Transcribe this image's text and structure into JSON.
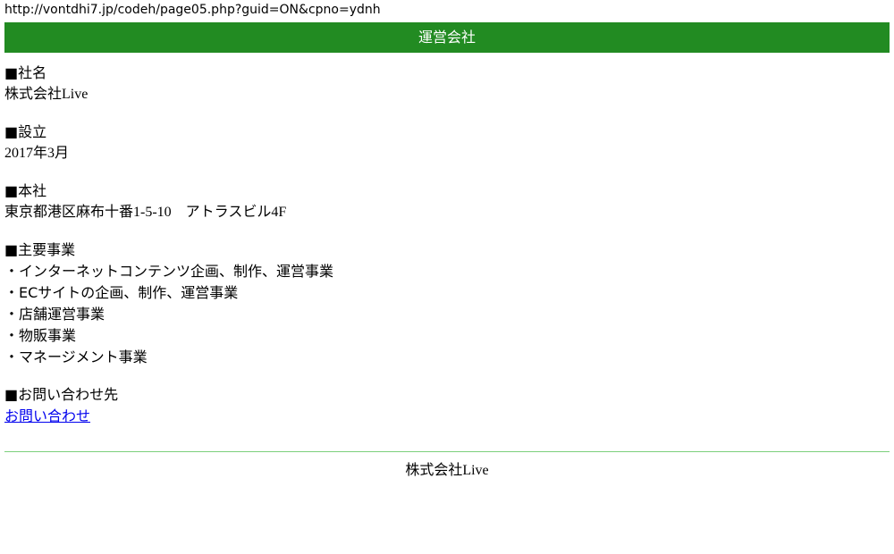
{
  "url": "http://vontdhi7.jp/codeh/page05.php?guid=ON&cpno=ydnh",
  "header": {
    "title": "運営会社"
  },
  "company_name": {
    "title": "■社名",
    "value": "株式会社Live"
  },
  "established": {
    "title": "■設立",
    "value": "2017年3月"
  },
  "head_office": {
    "title": "■本社",
    "value": "東京都港区麻布十番1-5-10　アトラスビル4F"
  },
  "business": {
    "title": "■主要事業",
    "items": [
      "・インターネットコンテンツ企画、制作、運営事業",
      "・ECサイトの企画、制作、運営事業",
      "・店舗運営事業",
      "・物販事業",
      "・マネージメント事業"
    ]
  },
  "contact": {
    "title": "■お問い合わせ先",
    "link_label": "お問い合わせ"
  },
  "footer": {
    "text": "株式会社Live"
  },
  "colors": {
    "header_bg": "#228b22",
    "divider": "#7ccf7c",
    "link": "#0000ee"
  }
}
